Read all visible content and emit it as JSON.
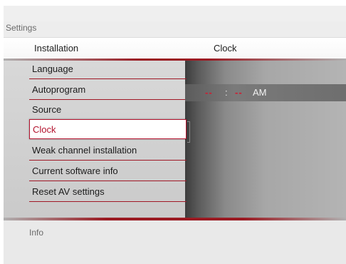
{
  "window": {
    "title": "Settings"
  },
  "columns": {
    "left_header": "Installation",
    "right_header": "Clock"
  },
  "menu": {
    "items": [
      {
        "label": "Language"
      },
      {
        "label": "Autoprogram"
      },
      {
        "label": "Source"
      },
      {
        "label": "Clock",
        "selected": true
      },
      {
        "label": "Weak channel installation"
      },
      {
        "label": "Current software info"
      },
      {
        "label": "Reset AV settings"
      }
    ]
  },
  "clock": {
    "hour_placeholder": "--",
    "separator": ":",
    "minute_placeholder": "--",
    "ampm": "AM"
  },
  "footer": {
    "info_label": "Info"
  },
  "colors": {
    "accent": "#b3122d",
    "divider": "#a01826"
  }
}
